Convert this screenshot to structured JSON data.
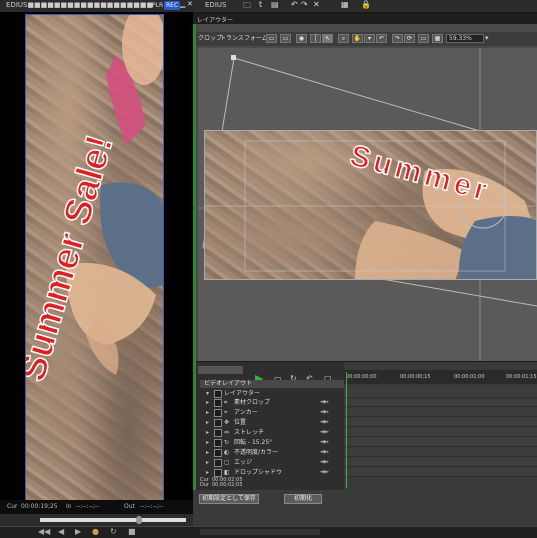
{
  "player": {
    "title": "EDIUS■■■■■■■■■■■■■■■■■■■",
    "pl_label": "PLR",
    "rec_label": "REC",
    "cur_label": "Cur",
    "cur_value": "00:00:19;25",
    "in_label": "In",
    "in_value": "--:--:--;--",
    "out_label": "Out",
    "out_value": "--:--:--;--",
    "overlay_text": "Summer Sale!"
  },
  "layouter": {
    "app_label": "EDIUS",
    "window_title": "レイアウター",
    "tabs": [
      "クロップ",
      "トランスフォーム"
    ],
    "zoom_value": "59.33%",
    "overlay_text": "Summer"
  },
  "effects": {
    "header_tab": "ビデオレイアウト",
    "group_label": "レイアウター",
    "items": [
      {
        "label": "素材クロップ",
        "icon": "crop-icon"
      },
      {
        "label": "アンカー",
        "icon": "anchor-icon"
      },
      {
        "label": "位置",
        "icon": "position-icon"
      },
      {
        "label": "ストレッチ",
        "icon": "stretch-icon"
      },
      {
        "label": "回転 - 15.25°",
        "icon": "rotate-icon"
      },
      {
        "label": "不透明度/カラー",
        "icon": "opacity-icon"
      },
      {
        "label": "エッジ",
        "icon": "edge-icon"
      },
      {
        "label": "ドロップシャドウ",
        "icon": "shadow-icon"
      }
    ],
    "cur_label": "Cur",
    "cur_value": "00:00:02;05",
    "dur_label": "Dur",
    "dur_value": "00:00:02;05"
  },
  "timeline": {
    "ruler": [
      "00:00:00;00",
      "00:00:00;15",
      "00:00:01;00",
      "00:00:01;15"
    ]
  },
  "buttons": {
    "save_default": "初期設定として保存",
    "reset": "初期化"
  },
  "colors": {
    "accent_green": "#3db03d",
    "selection_blue": "#3a5fb0",
    "text_red": "#e02020"
  }
}
